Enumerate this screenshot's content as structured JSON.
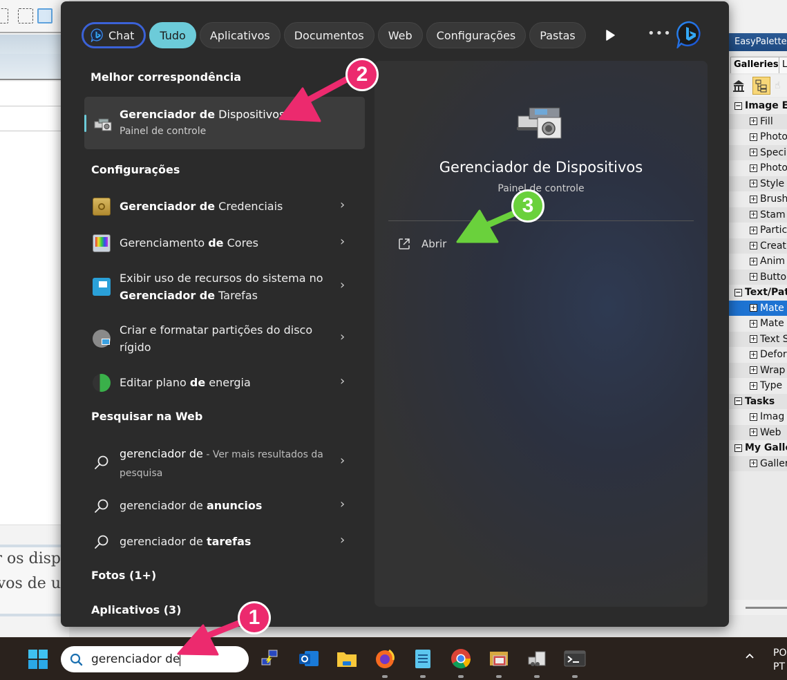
{
  "search_panel": {
    "filters": [
      {
        "label": "Chat",
        "state": "chat"
      },
      {
        "label": "Tudo",
        "state": "active"
      },
      {
        "label": "Aplicativos",
        "state": "normal"
      },
      {
        "label": "Documentos",
        "state": "normal"
      },
      {
        "label": "Web",
        "state": "normal"
      },
      {
        "label": "Configurações",
        "state": "normal"
      },
      {
        "label": "Pastas",
        "state": "normal"
      }
    ],
    "more_label": "•••",
    "best_match": {
      "section": "Melhor correspondência",
      "title_bold": "Gerenciador de",
      "title_rest": " Dispositivos",
      "subtitle": "Painel de controle",
      "icon": "device-manager-icon"
    },
    "settings": {
      "section": "Configurações",
      "items": [
        {
          "pre": "",
          "bold": "Gerenciador de",
          "post": " Credenciais",
          "icon": "credential-manager-icon"
        },
        {
          "pre": "Gerenciamento ",
          "bold": "de",
          "post": " Cores",
          "icon": "color-management-icon"
        },
        {
          "pre": "Exibir uso de recursos do sistema no ",
          "bold": "Gerenciador de",
          "post": " Tarefas",
          "icon": "task-manager-icon"
        },
        {
          "pre": "Criar e formatar partições do disco rígido",
          "bold": "",
          "post": "",
          "icon": "disk-partition-icon"
        },
        {
          "pre": "Editar plano ",
          "bold": "de",
          "post": " energia",
          "icon": "power-plan-icon"
        }
      ]
    },
    "web": {
      "section": "Pesquisar na Web",
      "items": [
        {
          "query": "gerenciador de",
          "bold": "",
          "suffix": " - Ver mais resultados da pesquisa"
        },
        {
          "query": "gerenciador de ",
          "bold": "anuncios",
          "suffix": ""
        },
        {
          "query": "gerenciador de ",
          "bold": "tarefas",
          "suffix": ""
        }
      ]
    },
    "photos_section": "Fotos (1+)",
    "apps_section": "Aplicativos (3)",
    "detail": {
      "title": "Gerenciador de Dispositivos",
      "subtitle": "Painel de controle",
      "open_label": "Abrir"
    }
  },
  "annotations": {
    "badge1": "1",
    "badge2": "2",
    "badge3": "3",
    "pink": "#ec2a6e",
    "green": "#6ad13c"
  },
  "taskbar": {
    "search_value": "gerenciador de",
    "apps": [
      "remote-desktop-icon",
      "outlook-icon",
      "file-explorer-icon",
      "firefox-icon",
      "notepad-icon",
      "chrome-icon",
      "photo-gallery-icon",
      "device-manager-icon",
      "terminal-icon"
    ],
    "tray_lang_1": "PO",
    "tray_lang_2": "PT"
  },
  "background_left": {
    "doc_line1": "ar os disp",
    "doc_line2": "ivos de u"
  },
  "easypalette": {
    "title": "EasyPalette",
    "tab_active": "Galleries",
    "tab_next": "L",
    "tree": [
      {
        "label": "Image Er",
        "type": "group"
      },
      {
        "label": "Fill",
        "type": "child"
      },
      {
        "label": "Photo",
        "type": "child"
      },
      {
        "label": "Speci",
        "type": "child"
      },
      {
        "label": "Photo",
        "type": "child"
      },
      {
        "label": "Style",
        "type": "child"
      },
      {
        "label": "Brush",
        "type": "child"
      },
      {
        "label": "Stam",
        "type": "child"
      },
      {
        "label": "Partic",
        "type": "child"
      },
      {
        "label": "Creat",
        "type": "child"
      },
      {
        "label": "Anim",
        "type": "child"
      },
      {
        "label": "Butto",
        "type": "child"
      },
      {
        "label": "Text/Pat",
        "type": "group"
      },
      {
        "label": "Mate",
        "type": "child",
        "selected": true
      },
      {
        "label": "Mate",
        "type": "child"
      },
      {
        "label": "Text S",
        "type": "child"
      },
      {
        "label": "Defor",
        "type": "child"
      },
      {
        "label": "Wrap",
        "type": "child"
      },
      {
        "label": "Type",
        "type": "child"
      },
      {
        "label": "Tasks",
        "type": "group"
      },
      {
        "label": "Imag",
        "type": "child"
      },
      {
        "label": "Web",
        "type": "child"
      },
      {
        "label": "My Galle",
        "type": "group"
      },
      {
        "label": "Galler",
        "type": "child"
      }
    ]
  }
}
